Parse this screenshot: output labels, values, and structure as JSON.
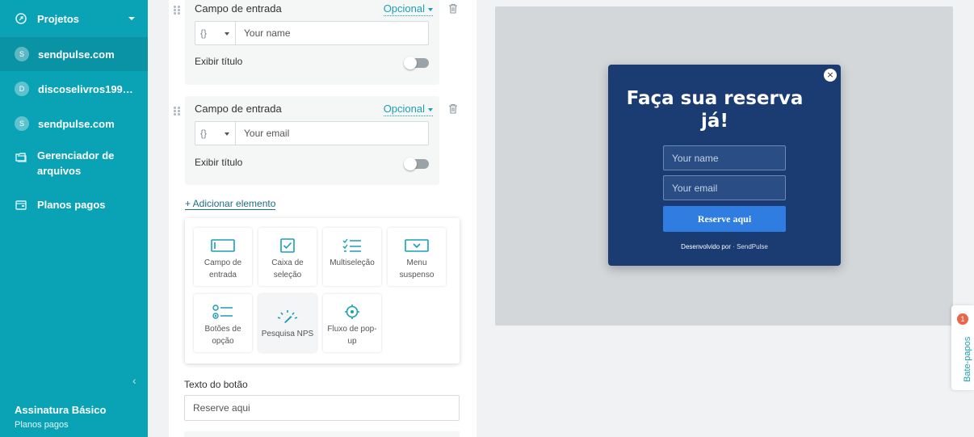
{
  "sidebar": {
    "items": [
      {
        "label": "Projetos",
        "icon": "rocket-icon"
      },
      {
        "label": "sendpulse.com",
        "avatar": "S"
      },
      {
        "label": "discoselivros1997....",
        "avatar": "D"
      },
      {
        "label": "sendpulse.com",
        "avatar": "S"
      },
      {
        "label": "Gerenciador de arquivos",
        "icon": "folder-icon"
      },
      {
        "label": "Planos pagos",
        "icon": "wallet-icon"
      }
    ],
    "plan_title": "Assinatura Básico",
    "plan_subtitle": "Planos pagos"
  },
  "editor": {
    "fields": [
      {
        "title": "Campo de entrada",
        "optional": "Opcional",
        "var_symbol": "{}",
        "value": "Your name",
        "show_title": "Exibir título"
      },
      {
        "title": "Campo de entrada",
        "optional": "Opcional",
        "var_symbol": "{}",
        "value": "Your email",
        "show_title": "Exibir título"
      }
    ],
    "add_element": "+ Adicionar elemento",
    "palette": [
      {
        "line1": "Campo de",
        "line2": "entrada",
        "icon": "input-field-icon"
      },
      {
        "line1": "Caixa de",
        "line2": "seleção",
        "icon": "checkbox-icon"
      },
      {
        "line1": "Multiseleção",
        "line2": "",
        "icon": "multiselect-icon"
      },
      {
        "line1": "Menu",
        "line2": "suspenso",
        "icon": "dropdown-icon"
      },
      {
        "line1": "Botões de",
        "line2": "opção",
        "icon": "radio-buttons-icon"
      },
      {
        "line1": "Pesquisa NPS",
        "line2": "",
        "icon": "nps-gauge-icon"
      },
      {
        "line1": "Fluxo de pop-",
        "line2": "up",
        "icon": "popup-flow-icon"
      }
    ],
    "button_text_label": "Texto do botão",
    "button_text_value": "Reserve aqui"
  },
  "preview": {
    "title": "Faça sua reserva já!",
    "name_placeholder": "Your name",
    "email_placeholder": "Your email",
    "button": "Reserve aqui",
    "credit_prefix": "Desenvolvido por",
    "credit_brand": "SendPulse",
    "close": "×"
  },
  "chat": {
    "label": "Bate-papos",
    "badge": "1"
  },
  "colors": {
    "sidebar": "#0aa3b5",
    "accent": "#1a9fb3",
    "popup_bg": "#1b3c73",
    "popup_button": "#2f7de1"
  }
}
